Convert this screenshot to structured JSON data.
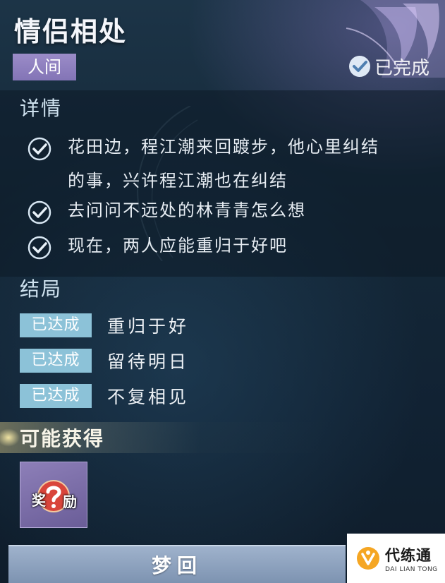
{
  "quest": {
    "title": "情侣相处",
    "realm_tag": "人间",
    "status": "已完成"
  },
  "details": {
    "heading": "详情",
    "steps": [
      {
        "line1": "花田边，程江潮来回踱步，他心里纠结",
        "line2": "的事，兴许程江潮也在纠结"
      },
      {
        "line1": "去问问不远处的林青青怎么想"
      },
      {
        "line1": "现在，两人应能重归于好吧"
      }
    ]
  },
  "endings": {
    "heading": "结局",
    "items": [
      {
        "badge": "已达成",
        "label": "重归于好"
      },
      {
        "badge": "已达成",
        "label": "留待明日"
      },
      {
        "badge": "已达成",
        "label": "不复相见"
      }
    ]
  },
  "rewards": {
    "heading": "可能获得",
    "item_text_left": "奖",
    "item_text_right": "励"
  },
  "action": {
    "button_label": "梦回"
  },
  "watermark": {
    "name_cn": "代练通",
    "name_en": "DAI LIAN TONG"
  },
  "colors": {
    "realm_tag": "#8e7fbf",
    "ending_badge": "#8cc2d8",
    "reward_item": "#7b6eab",
    "button": "#8aa0bd",
    "watermark_logo": "#f5a623"
  }
}
